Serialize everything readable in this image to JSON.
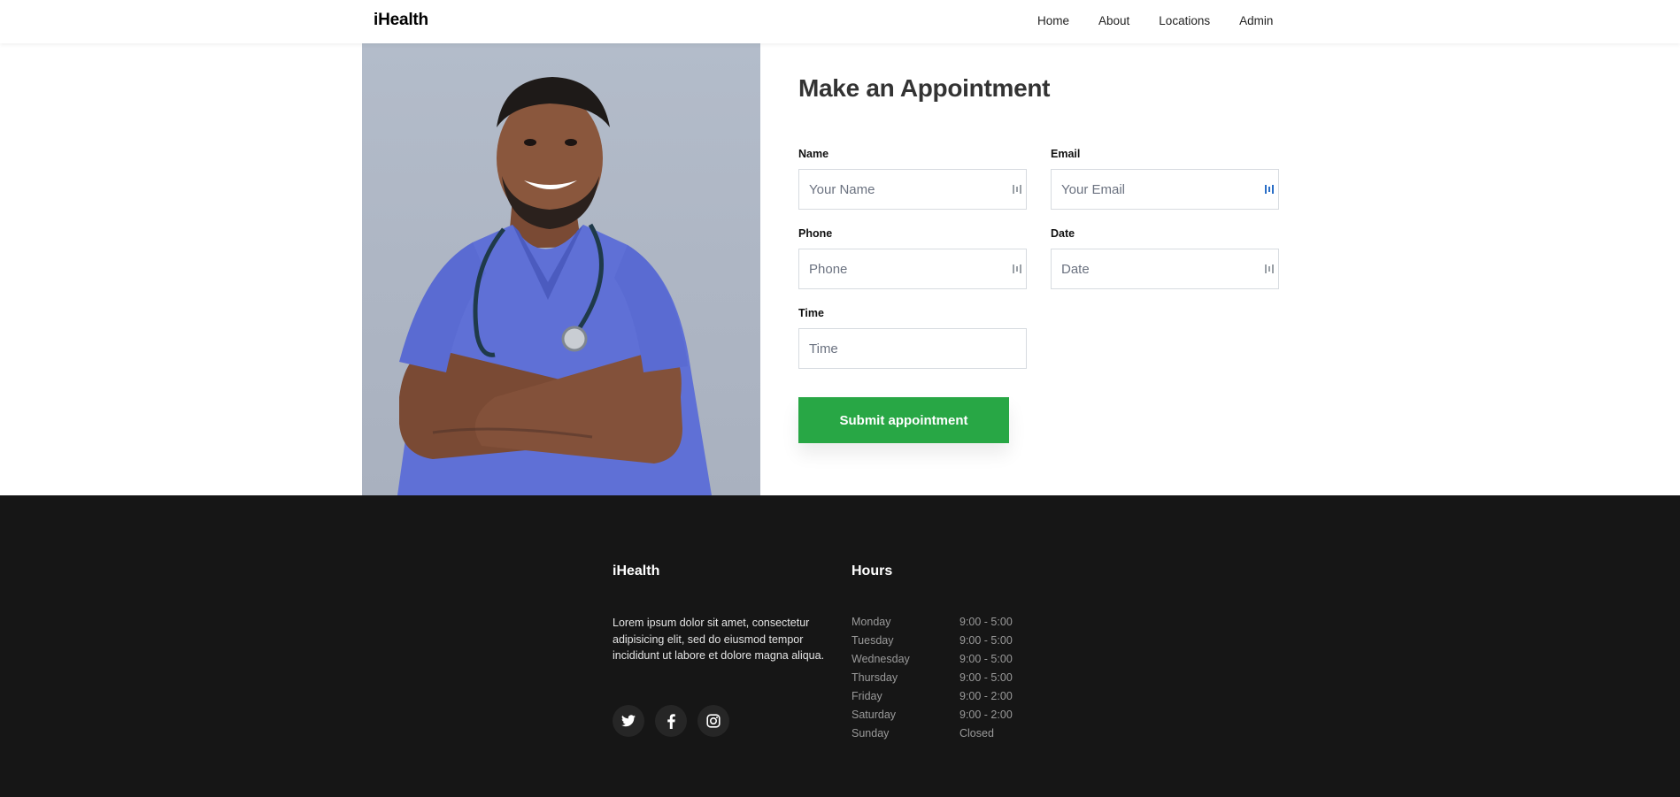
{
  "nav": {
    "brand": "iHealth",
    "links": [
      "Home",
      "About",
      "Locations",
      "Admin"
    ]
  },
  "form": {
    "title": "Make an Appointment",
    "fields": {
      "name": {
        "label": "Name",
        "placeholder": "Your Name"
      },
      "email": {
        "label": "Email",
        "placeholder": "Your Email"
      },
      "phone": {
        "label": "Phone",
        "placeholder": "Phone"
      },
      "date": {
        "label": "Date",
        "placeholder": "Date"
      },
      "time": {
        "label": "Time",
        "placeholder": "Time"
      }
    },
    "submit_label": "Submit appointment"
  },
  "footer": {
    "brand": "iHealth",
    "text": "Lorem ipsum dolor sit amet, consectetur adipisicing elit, sed do eiusmod tempor incididunt ut labore et dolore magna aliqua.",
    "social": [
      "twitter-icon",
      "facebook-icon",
      "instagram-icon"
    ],
    "hours_title": "Hours",
    "hours": [
      {
        "day": "Monday",
        "time": "9:00 - 5:00"
      },
      {
        "day": "Tuesday",
        "time": "9:00 - 5:00"
      },
      {
        "day": "Wednesday",
        "time": "9:00 - 5:00"
      },
      {
        "day": "Thursday",
        "time": "9:00 - 5:00"
      },
      {
        "day": "Friday",
        "time": "9:00 - 2:00"
      },
      {
        "day": "Saturday",
        "time": "9:00 - 2:00"
      },
      {
        "day": "Sunday",
        "time": "Closed"
      }
    ]
  },
  "colors": {
    "primary_button": "#28a745",
    "footer_bg": "#161616",
    "photo_bg": "#b3bcca",
    "scrub_blue": "#6a7ee0"
  }
}
